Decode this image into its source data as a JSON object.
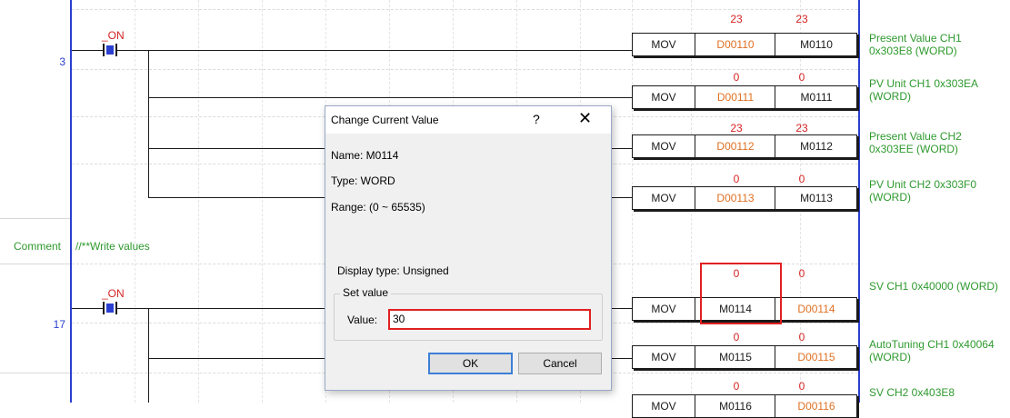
{
  "rungs": [
    {
      "row_number": "3",
      "contact_label": "_ON"
    },
    {
      "row_number": "17",
      "contact_label": "_ON"
    }
  ],
  "comment_row": {
    "label": "Comment",
    "text": "//**Write values"
  },
  "instructions": [
    {
      "op": "MOV",
      "src": "D00110",
      "dst": "M0110",
      "src_value": "23",
      "dst_value": "23",
      "comment": "Present Value CH1 0x303E8 (WORD)"
    },
    {
      "op": "MOV",
      "src": "D00111",
      "dst": "M0111",
      "src_value": "0",
      "dst_value": "0",
      "comment": "PV Unit CH1 0x303EA (WORD)"
    },
    {
      "op": "MOV",
      "src": "D00112",
      "dst": "M0112",
      "src_value": "23",
      "dst_value": "23",
      "comment": "Present Value CH2 0x303EE (WORD)"
    },
    {
      "op": "MOV",
      "src": "D00113",
      "dst": "M0113",
      "src_value": "0",
      "dst_value": "0",
      "comment": "PV Unit CH2 0x303F0 (WORD)"
    },
    {
      "op": "MOV",
      "src": "M0114",
      "dst": "D00114",
      "src_value": "0",
      "dst_value": "0",
      "comment": "SV CH1 0x40000 (WORD)"
    },
    {
      "op": "MOV",
      "src": "M0115",
      "dst": "D00115",
      "src_value": "0",
      "dst_value": "0",
      "comment": "AutoTuning CH1 0x40064 (WORD)"
    },
    {
      "op": "MOV",
      "src": "M0116",
      "dst": "D00116",
      "src_value": "0",
      "dst_value": "0",
      "comment": "SV CH2 0x403E8"
    }
  ],
  "dialog": {
    "title": "Change Current Value",
    "help": "?",
    "close": "✕",
    "name_line": "Name:  M0114",
    "type_line": "Type:   WORD",
    "range_line": "Range: (0 ~ 65535)",
    "display_type_line": "Display type:  Unsigned",
    "group_title": "Set value",
    "value_label": "Value:",
    "value": "30",
    "ok_label": "OK",
    "cancel_label": "Cancel"
  },
  "colors": {
    "rail": "#2a3fd0",
    "contact_label": "#d62424",
    "comment": "#2e9a2e",
    "device_orange": "#e07022",
    "highlight": "#e02020"
  }
}
